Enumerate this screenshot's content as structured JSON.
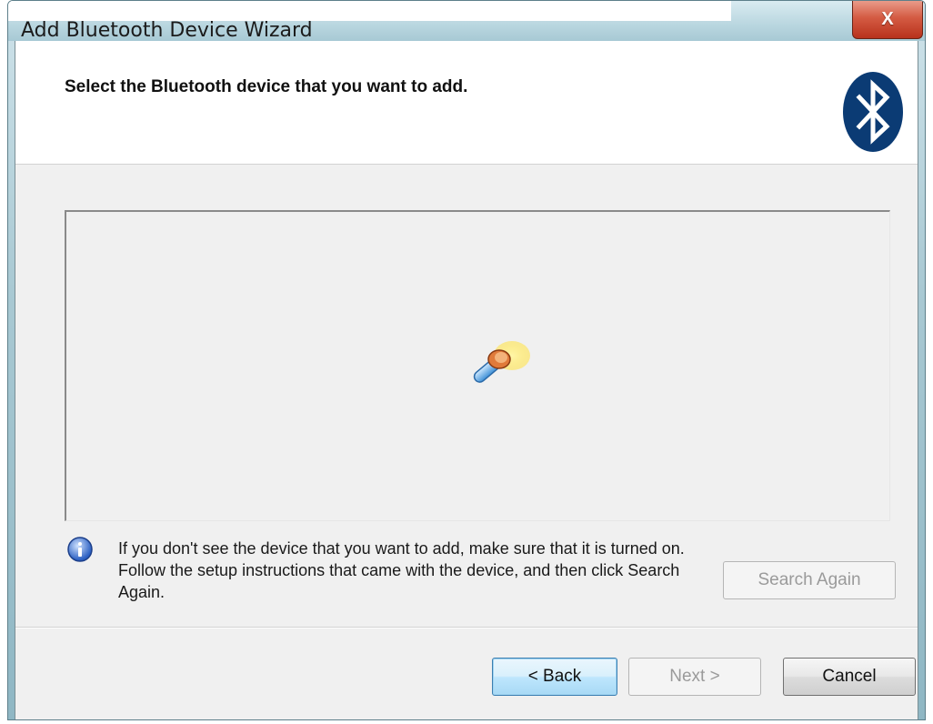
{
  "window": {
    "title": "Add Bluetooth Device Wizard",
    "close_label": "X"
  },
  "header": {
    "title": "Select the Bluetooth device that you want to add.",
    "logo_icon": "bluetooth-logo-icon"
  },
  "device_list": {
    "status_icon": "searching-flashlight-icon"
  },
  "info": {
    "icon": "info-icon",
    "text": "If you don't see the device that you want to add, make sure that it is turned on. Follow the setup instructions that came with the device, and then click Search Again."
  },
  "buttons": {
    "search_again": "Search Again",
    "back": "< Back",
    "next": "Next >",
    "cancel": "Cancel"
  },
  "colors": {
    "bluetooth_blue": "#0b3b74",
    "close_red": "#c8412a"
  }
}
